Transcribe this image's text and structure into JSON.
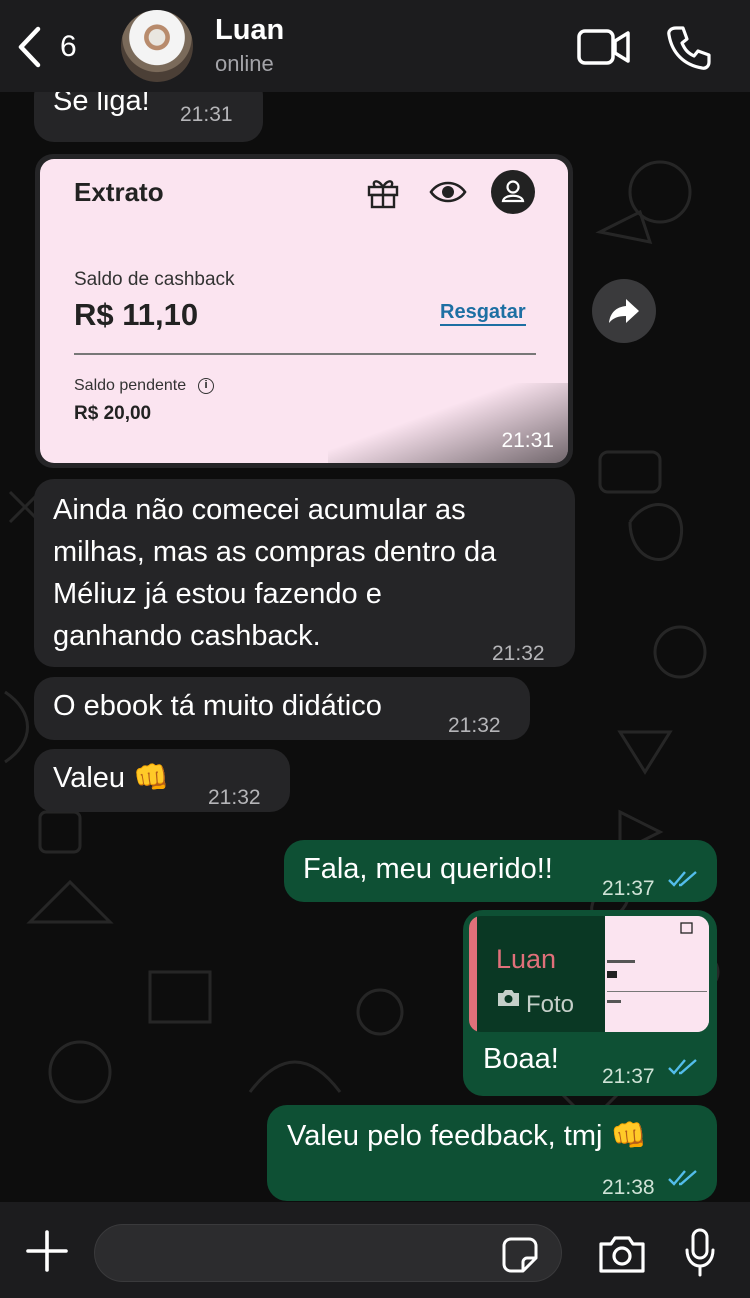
{
  "header": {
    "back_count": "6",
    "contact_name": "Luan",
    "status": "online"
  },
  "messages": {
    "m1": {
      "text": "Se liga!",
      "time": "21:31"
    },
    "image": {
      "time": "21:31",
      "title": "Extrato",
      "cashback_label": "Saldo de cashback",
      "cashback_amount": "R$ 11,10",
      "redeem_link": "Resgatar",
      "pending_label": "Saldo pendente",
      "pending_amount": "R$ 20,00"
    },
    "m2": {
      "lines": [
        "Ainda não comecei acumular as",
        "milhas, mas as compras dentro da",
        "Méliuz já estou fazendo e",
        "ganhando cashback."
      ],
      "time": "21:32"
    },
    "m3": {
      "text": "O ebook tá muito didático",
      "time": "21:32"
    },
    "m4": {
      "text": "Valeu 👊",
      "time": "21:32"
    },
    "m5": {
      "text": "Fala, meu querido!!",
      "time": "21:37"
    },
    "m6": {
      "quote_name": "Luan",
      "quote_type": "Foto",
      "text": "Boaa!",
      "time": "21:37"
    },
    "m7": {
      "text": "Valeu pelo feedback, tmj 👊",
      "time": "21:38"
    }
  },
  "input": {
    "placeholder": ""
  },
  "colors": {
    "incoming": "#252527",
    "outgoing": "#0e5034",
    "read_ticks": "#53bdeb",
    "quote_accent": "#e0707a"
  }
}
